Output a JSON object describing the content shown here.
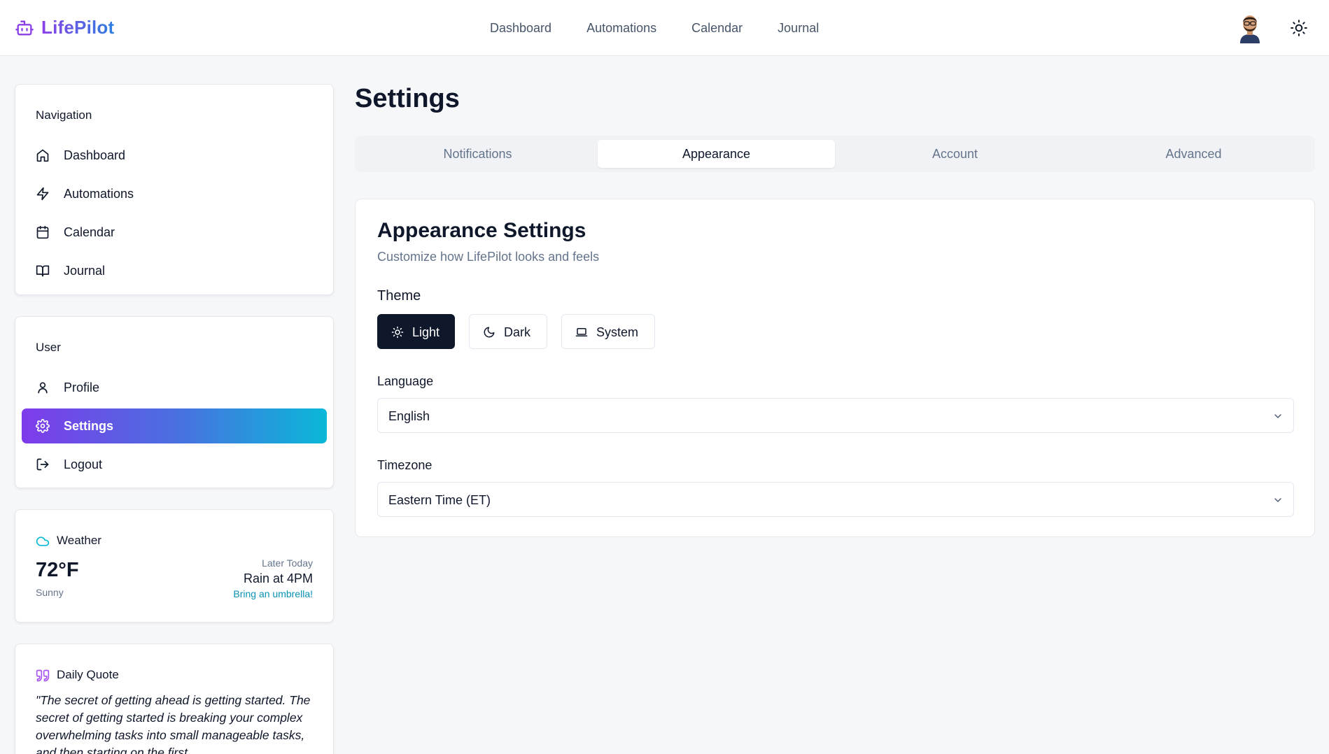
{
  "app": {
    "name": "LifePilot"
  },
  "topnav": [
    "Dashboard",
    "Automations",
    "Calendar",
    "Journal"
  ],
  "sidebar": {
    "navigation": {
      "title": "Navigation",
      "items": [
        {
          "label": "Dashboard",
          "icon": "home-icon"
        },
        {
          "label": "Automations",
          "icon": "lightning-icon"
        },
        {
          "label": "Calendar",
          "icon": "calendar-icon"
        },
        {
          "label": "Journal",
          "icon": "book-icon"
        }
      ]
    },
    "user": {
      "title": "User",
      "items": [
        {
          "label": "Profile",
          "icon": "user-icon"
        },
        {
          "label": "Settings",
          "icon": "gear-icon",
          "active": true
        },
        {
          "label": "Logout",
          "icon": "logout-icon"
        }
      ]
    },
    "weather": {
      "title": "Weather",
      "temperature": "72°F",
      "condition": "Sunny",
      "later_label": "Later Today",
      "forecast": "Rain at 4PM",
      "tip": "Bring an umbrella!"
    },
    "quote": {
      "title": "Daily Quote",
      "text": "\"The secret of getting ahead is getting started. The secret of getting started is breaking your complex overwhelming tasks into small manageable tasks, and then starting on the first"
    }
  },
  "main": {
    "title": "Settings",
    "tabs": [
      {
        "label": "Notifications"
      },
      {
        "label": "Appearance",
        "active": true
      },
      {
        "label": "Account"
      },
      {
        "label": "Advanced"
      }
    ],
    "panel": {
      "title": "Appearance Settings",
      "description": "Customize how LifePilot looks and feels",
      "theme_label": "Theme",
      "theme_options": [
        {
          "label": "Light",
          "icon": "sun-icon",
          "selected": true
        },
        {
          "label": "Dark",
          "icon": "moon-icon"
        },
        {
          "label": "System",
          "icon": "laptop-icon"
        }
      ],
      "language_label": "Language",
      "language_value": "English",
      "timezone_label": "Timezone",
      "timezone_value": "Eastern Time (ET)"
    }
  },
  "colors": {
    "accent_purple": "#7e3bea",
    "accent_cyan": "#0ab8d8",
    "primary_dark": "#0f172a",
    "link_cyan": "#0891b2"
  }
}
